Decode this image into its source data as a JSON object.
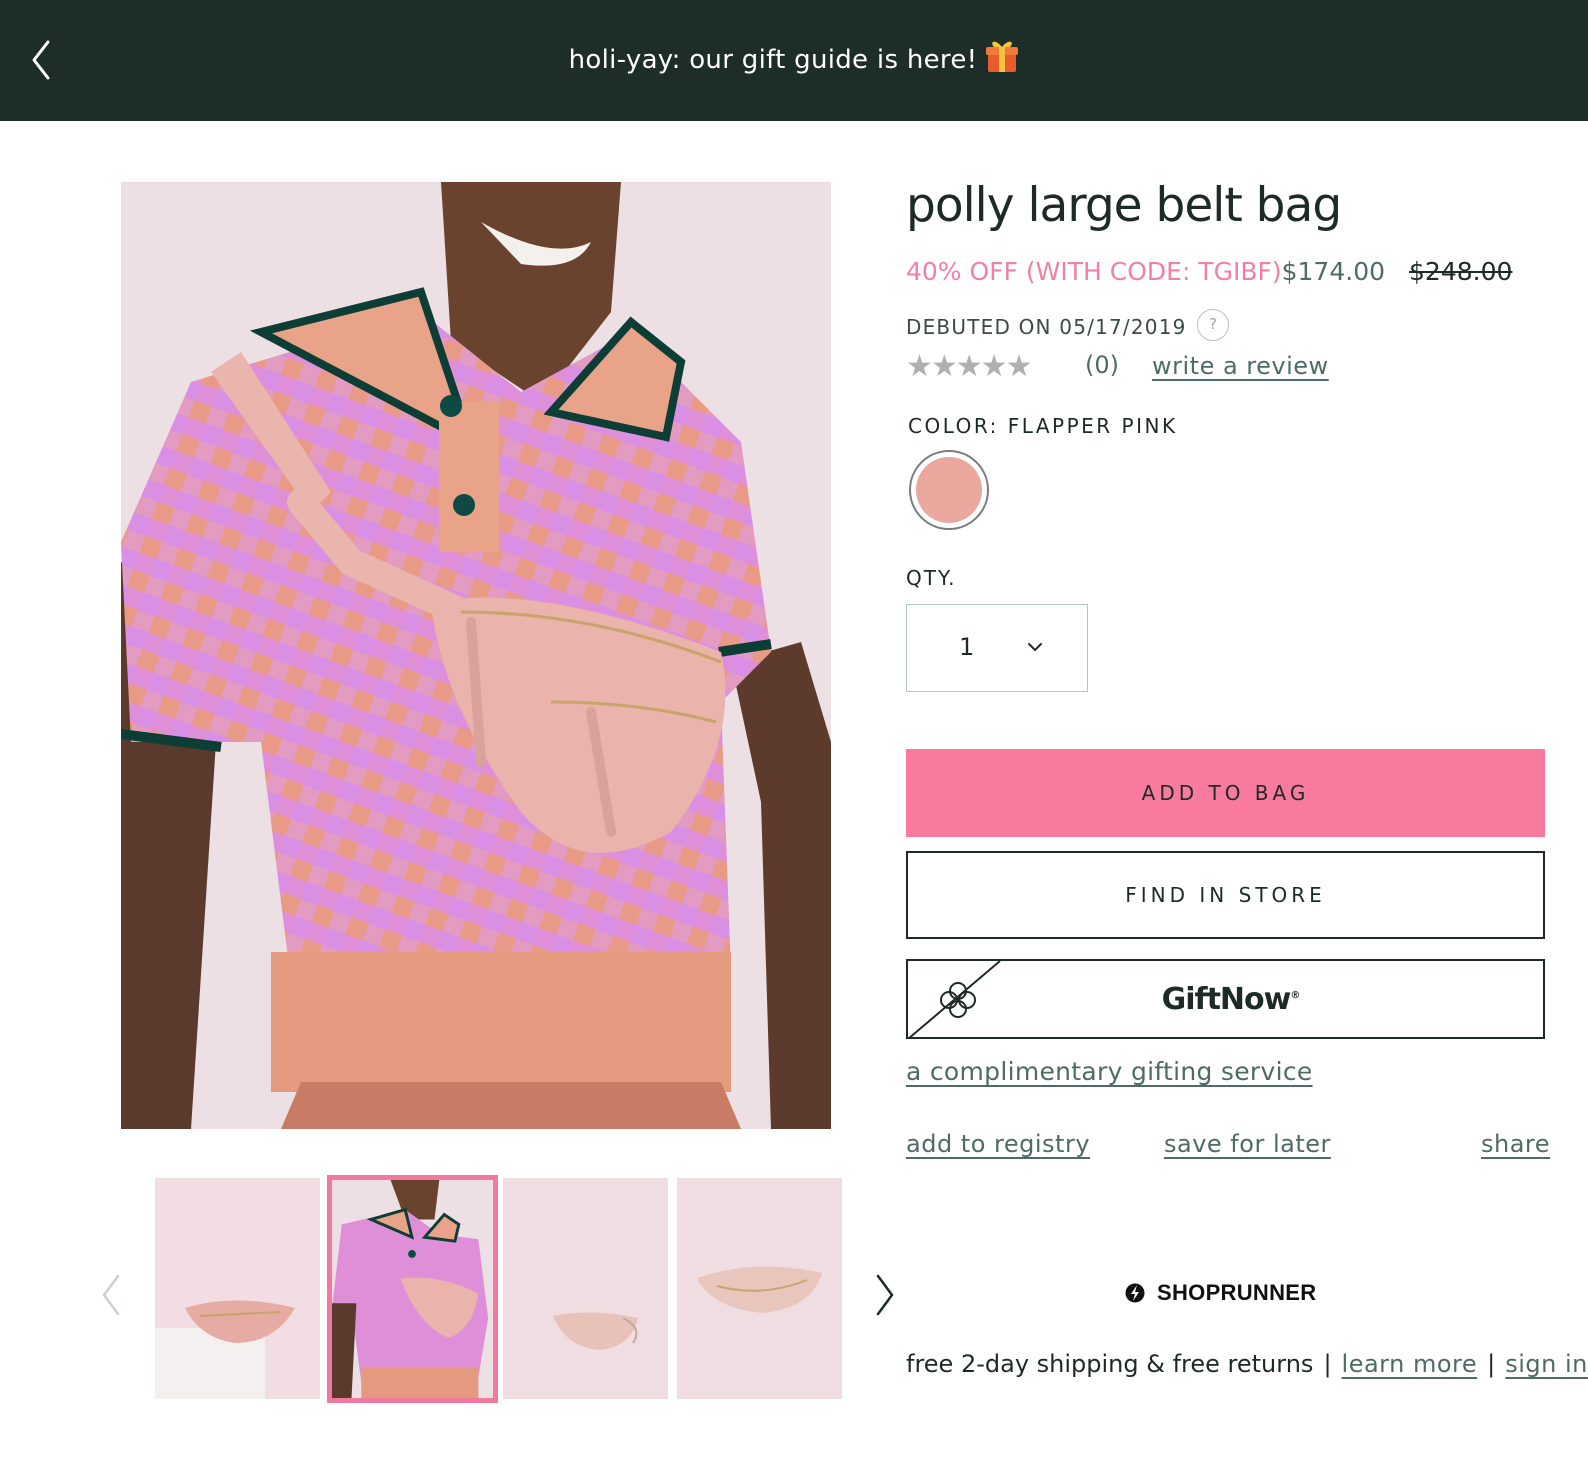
{
  "banner": {
    "message": "holi-yay: our gift guide is here!",
    "icons": {
      "back": "chevron-left-icon",
      "gift": "gift-icon"
    },
    "background": "#1c2e27"
  },
  "product": {
    "title": "polly large belt bag",
    "promo_text": "40% OFF (WITH CODE: TGIBF)",
    "sale_price": "$174.00",
    "original_price": "$248.00",
    "debuted": "DEBUTED ON 05/17/2019",
    "help_symbol": "?",
    "stars": "★★★★★",
    "review_count": "(0)",
    "write_review": "write a review",
    "color_label": "COLOR: FLAPPER PINK",
    "swatch_color": "#eaa79e",
    "qty_label": "QTY.",
    "qty_value": "1"
  },
  "actions": {
    "add_to_bag": "ADD TO BAG",
    "find_in_store": "FIND IN STORE",
    "giftnow": "GiftNow",
    "giftnow_reg": "®",
    "gifting_service": "a complimentary gifting service",
    "add_to_registry": "add to registry",
    "save_for_later": "save for later",
    "share": "share"
  },
  "shoprunner": {
    "brand": "SHOPRUNNER",
    "shipping_text": "free 2-day shipping & free returns",
    "separator": "|",
    "learn_more": "learn more",
    "sign_in": "sign in"
  },
  "gallery": {
    "selected_index": 1,
    "thumbnails": [
      "bag-front-on-pedestal",
      "model-wearing-bag",
      "bag-side-small",
      "bag-top-open"
    ]
  },
  "colors": {
    "accent_pink": "#f87b9e",
    "promo_pink": "#f27fa5",
    "link_green": "#4f6b66",
    "thumb_selected_border": "#f1799f"
  }
}
